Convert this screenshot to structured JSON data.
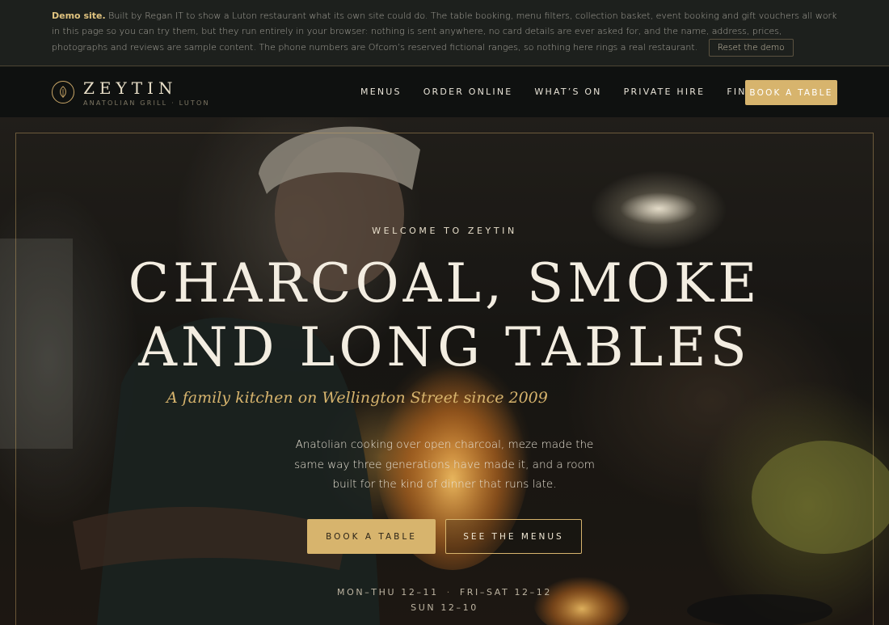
{
  "demo_banner": {
    "label": "Demo site.",
    "text": "Built by Regan IT to show a Luton restaurant what its own site could do. The table booking, menu filters, collection basket, event booking and gift vouchers all work in this page so you can try them, but they run entirely in your browser: nothing is sent anywhere, no card details are ever asked for, and the name, address, prices, photographs and reviews are sample content. The phone numbers are Ofcom’s reserved fictional ranges, so nothing here rings a real restaurant.",
    "reset_label": "Reset the demo"
  },
  "brand": {
    "name": "ZEYTIN",
    "tagline": "ANATOLIAN GRILL · LUTON",
    "icon": "olive-leaf-icon"
  },
  "nav": {
    "items": [
      {
        "label": "MENUS"
      },
      {
        "label": "ORDER ONLINE"
      },
      {
        "label": "WHAT’S ON"
      },
      {
        "label": "PRIVATE HIRE"
      },
      {
        "label": "FIND US"
      }
    ],
    "cta_label": "BOOK A TABLE"
  },
  "hero": {
    "eyebrow": "WELCOME TO ZEYTIN",
    "title_line1": "CHARCOAL, SMOKE",
    "title_line2": "AND LONG TABLES",
    "subtitle": "A family kitchen on Wellington Street since 2009",
    "body": "Anatolian cooking over open charcoal, meze made the same way three generations have made it, and a room built for the kind of dinner that runs late.",
    "primary_button": "BOOK A TABLE",
    "secondary_button": "SEE THE MENUS",
    "hours": {
      "weekday": "MON–THU 12–11",
      "weekend": "FRI–SAT 12–12",
      "sunday": "SUN 12–10"
    }
  },
  "colors": {
    "accent": "#d7b46d",
    "nav_bg": "#0f1110",
    "banner_bg": "#1d201d"
  }
}
